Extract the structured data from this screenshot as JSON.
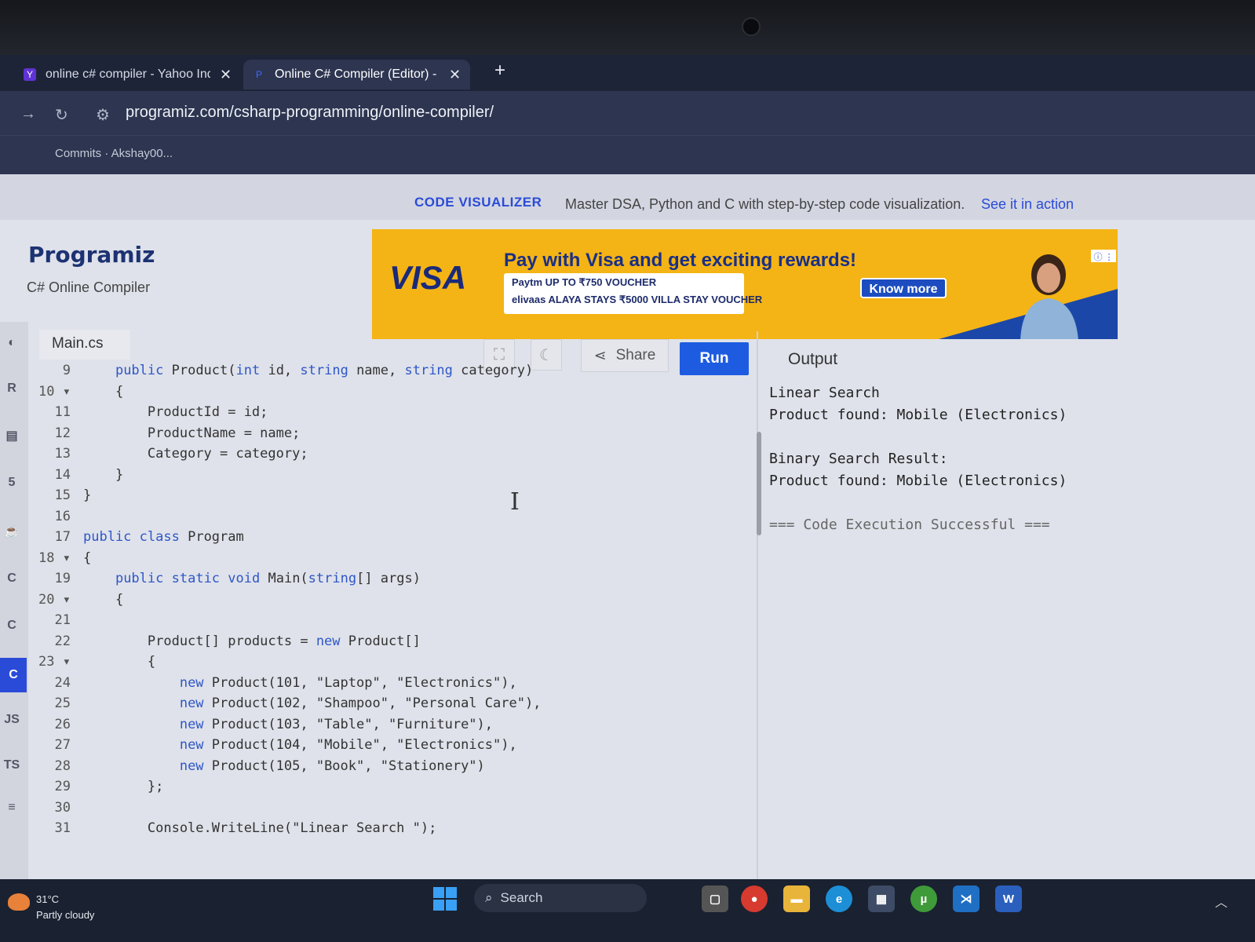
{
  "browser": {
    "tabs": [
      {
        "title": "online c# compiler - Yahoo Ind",
        "icon": "yahoo-icon",
        "active": false
      },
      {
        "title": "Online C# Compiler (Editor) - P",
        "icon": "programiz-icon",
        "active": true
      }
    ],
    "new_tab_label": "+",
    "url": "programiz.com/csharp-programming/online-compiler/",
    "bookmark": "Commits · Akshay00..."
  },
  "promo": {
    "label": "CODE VISUALIZER",
    "text": "Master DSA, Python and C with step-by-step code visualization.",
    "link": "See it in action"
  },
  "brand": {
    "logo": "Programiz",
    "subtitle": "C# Online Compiler"
  },
  "ad": {
    "brand": "VISA",
    "headline": "Pay with Visa and get exciting rewards!",
    "line1": "Paytm UP TO ₹750 VOUCHER",
    "line2": "elivaas ALAYA STAYS ₹5000 VILLA STAY VOUCHER",
    "cta": "Know more"
  },
  "editor": {
    "file": "Main.cs",
    "lines": [
      {
        "n": "9",
        "code": "    public Product(int id, string name, string category)"
      },
      {
        "n": "10 ▾",
        "code": "    {"
      },
      {
        "n": "11",
        "code": "        ProductId = id;"
      },
      {
        "n": "12",
        "code": "        ProductName = name;"
      },
      {
        "n": "13",
        "code": "        Category = category;"
      },
      {
        "n": "14",
        "code": "    }"
      },
      {
        "n": "15",
        "code": "}"
      },
      {
        "n": "16",
        "code": ""
      },
      {
        "n": "17",
        "code": "public class Program"
      },
      {
        "n": "18 ▾",
        "code": "{"
      },
      {
        "n": "19",
        "code": "    public static void Main(string[] args)"
      },
      {
        "n": "20 ▾",
        "code": "    {"
      },
      {
        "n": "21",
        "code": ""
      },
      {
        "n": "22",
        "code": "        Product[] products = new Product[]"
      },
      {
        "n": "23 ▾",
        "code": "        {"
      },
      {
        "n": "24",
        "code": "            new Product(101, \"Laptop\", \"Electronics\"),"
      },
      {
        "n": "25",
        "code": "            new Product(102, \"Shampoo\", \"Personal Care\"),"
      },
      {
        "n": "26",
        "code": "            new Product(103, \"Table\", \"Furniture\"),"
      },
      {
        "n": "27",
        "code": "            new Product(104, \"Mobile\", \"Electronics\"),"
      },
      {
        "n": "28",
        "code": "            new Product(105, \"Book\", \"Stationery\")"
      },
      {
        "n": "29",
        "code": "        };"
      },
      {
        "n": "30",
        "code": ""
      },
      {
        "n": "31",
        "code": "        Console.WriteLine(\"Linear Search \");"
      }
    ]
  },
  "toolbar": {
    "share": "Share",
    "run": "Run",
    "output": "Output"
  },
  "output": {
    "lines": [
      "Linear Search",
      "Product found: Mobile (Electronics)",
      "",
      "Binary Search Result:",
      "Product found: Mobile (Electronics)",
      "",
      "=== Code Execution Successful ==="
    ]
  },
  "sidebar": {
    "items": [
      "python-icon",
      "r-icon",
      "sql-icon",
      "html-icon",
      "java-icon",
      "c-icon",
      "cpp-icon",
      "csharp-icon",
      "JS",
      "TS",
      "go-icon"
    ]
  },
  "taskbar": {
    "weather_temp": "31°C",
    "weather_desc": "Partly cloudy",
    "search": "Search"
  },
  "colors": {
    "accent": "#1d5ce0",
    "keyword": "#2e56c8",
    "ad_bg": "#f4b415"
  }
}
